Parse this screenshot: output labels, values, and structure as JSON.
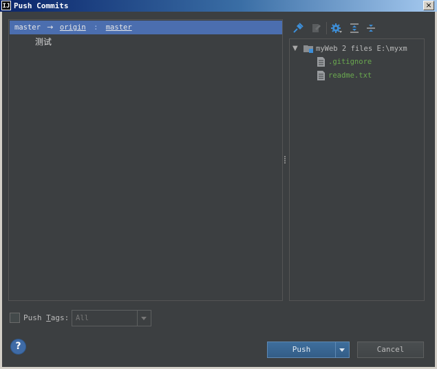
{
  "window": {
    "title": "Push Commits",
    "app_icon_text": "IJ",
    "close_glyph": "×"
  },
  "branch": {
    "source": "master",
    "arrow": "→",
    "remote": "origin",
    "separator": ":",
    "target": "master"
  },
  "commits": [
    {
      "message": "测试"
    }
  ],
  "toolbar": {
    "icons": [
      "pin-icon",
      "edit-source-icon",
      "settings-icon",
      "expand-all-icon",
      "collapse-all-icon"
    ]
  },
  "tree": {
    "root": {
      "label": "myWeb  2 files  E:\\myxm"
    },
    "files": [
      {
        "name": ".gitignore"
      },
      {
        "name": "readme.txt"
      }
    ]
  },
  "push_tags": {
    "label_prefix": "Push ",
    "label_underlined": "T",
    "label_suffix": "ags:",
    "checked": false,
    "select_value": "All"
  },
  "buttons": {
    "help": "?",
    "push": "Push",
    "cancel": "Cancel"
  },
  "colors": {
    "background": "#3c3f41",
    "selection": "#4b6eaf",
    "file_added": "#6aa84f",
    "accent_blue": "#3d8fd9"
  }
}
